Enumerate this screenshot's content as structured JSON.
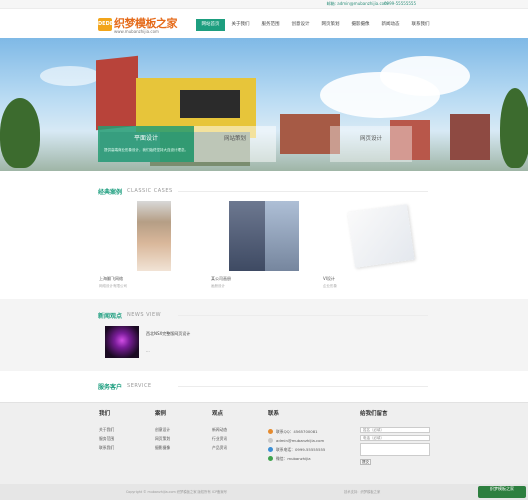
{
  "topbar": {
    "email": "邮箱: admin@mubanzhijia.com",
    "phone": "0999-55555555"
  },
  "header": {
    "logo_badge": "DEDE",
    "logo_name": "织梦模板之家",
    "logo_url": "www.mubanzhijia.com",
    "nav": [
      "网站首页",
      "关于我们",
      "服务范围",
      "创意设计",
      "网页策划",
      "摄影摄像",
      "新闻动态",
      "联系我们"
    ],
    "active_index": 0
  },
  "banner": {
    "caption_active_title": "平面设计",
    "caption_active_desc": "提供高端商业形象设计，我们始终坚持大连设计理念。",
    "caption_items": [
      "网站策划",
      "网页设计"
    ]
  },
  "cases": {
    "title_cn": "经典案例",
    "title_en": "CLASSIC CASES",
    "items": [
      {
        "caption": "上海翻飞网络",
        "sub": "网络设计有限公司"
      },
      {
        "caption": "某公司画册",
        "sub": "画册设计"
      },
      {
        "caption": "VI设计",
        "sub": "企业形象"
      }
    ]
  },
  "news": {
    "title_cn": "新闻观点",
    "title_en": "NEWS VIEW",
    "item_title": "西北NSX完整版网页设计",
    "item_more": "..."
  },
  "service": {
    "title_cn": "服务客户",
    "title_en": "SERVICE"
  },
  "footer": {
    "col_about": {
      "head": "我们",
      "links": [
        "关于我们",
        "服务范围",
        "联系我们"
      ]
    },
    "col_cases": {
      "head": "案例",
      "links": [
        "创意设计",
        "网页策划",
        "摄影摄像"
      ]
    },
    "col_views": {
      "head": "观点",
      "links": [
        "新闻动态",
        "行业资讯",
        "产品资讯"
      ]
    },
    "col_contact": {
      "head": "联系",
      "rows": [
        "联系QQ：4565700081",
        "admin@mubanzhijia.com",
        "联系电话：0999-55555555",
        "微信：mubanzhijia"
      ]
    },
    "col_message": {
      "head": "给我们留言",
      "name_placeholder": "姓名（必填）",
      "phone_placeholder": "电话（必填）",
      "submit": "提交"
    }
  },
  "copyright": {
    "left": "Copyright © mubanzhijia.com 织梦模板之家 版权所有  ICP备案号",
    "right": "技术支持：织梦模板之家"
  },
  "watermark": "织梦模板之家"
}
